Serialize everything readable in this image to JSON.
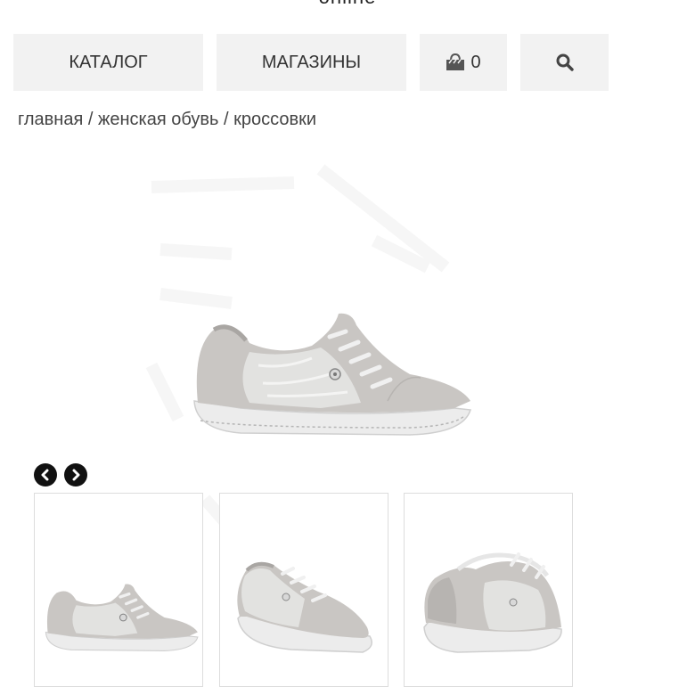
{
  "header": {
    "cut_off_text": "online"
  },
  "nav": {
    "catalog_label": "КАТАЛОГ",
    "stores_label": "МАГАЗИНЫ",
    "cart_count": "0",
    "cart_icon": "shopping-bag-icon",
    "search_icon": "search-icon"
  },
  "breadcrumb": {
    "home": "главная",
    "category": "женская обувь",
    "current": "кроссовки",
    "separator": "/"
  },
  "gallery": {
    "prev_icon": "chevron-left-icon",
    "next_icon": "chevron-right-icon",
    "thumbnails": [
      "side-view",
      "front-three-quarter-view",
      "back-three-quarter-view"
    ]
  },
  "colors": {
    "nav_bg": "#f2f2f2",
    "shoe_suede": "#c9c6c3",
    "shoe_metallic": "#e2e2e0",
    "sole": "#ececec"
  }
}
